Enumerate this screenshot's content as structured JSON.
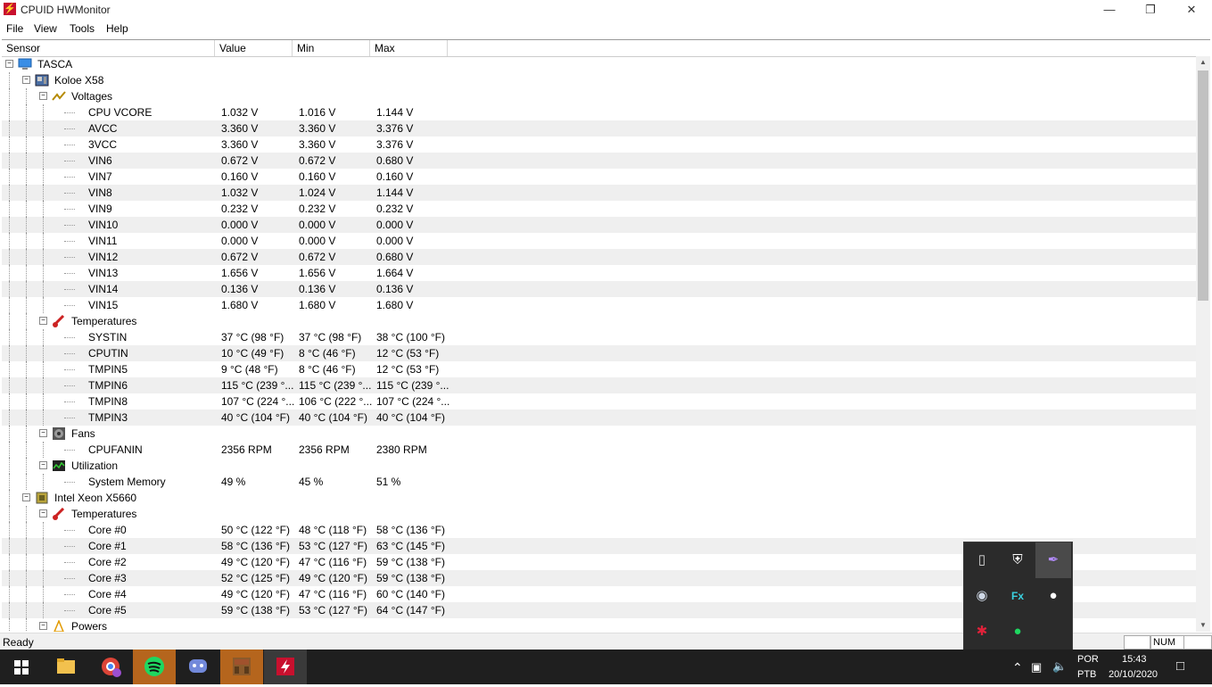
{
  "window": {
    "title": "CPUID HWMonitor",
    "app_icon": "⚡"
  },
  "menu": [
    "File",
    "View",
    "Tools",
    "Help"
  ],
  "columns": [
    "Sensor",
    "Value",
    "Min",
    "Max"
  ],
  "rows": [
    {
      "level": 0,
      "label": "TASCA",
      "icon": "computer-icon",
      "expandable": true
    },
    {
      "level": 1,
      "label": "Koloe X58",
      "icon": "motherboard-icon",
      "expandable": true
    },
    {
      "level": 2,
      "label": "Voltages",
      "icon": "voltage-icon",
      "expandable": true
    },
    {
      "level": 3,
      "label": "CPU VCORE",
      "value": "1.032 V",
      "min": "1.016 V",
      "max": "1.144 V"
    },
    {
      "level": 3,
      "label": "AVCC",
      "value": "3.360 V",
      "min": "3.360 V",
      "max": "3.376 V"
    },
    {
      "level": 3,
      "label": "3VCC",
      "value": "3.360 V",
      "min": "3.360 V",
      "max": "3.376 V"
    },
    {
      "level": 3,
      "label": "VIN6",
      "value": "0.672 V",
      "min": "0.672 V",
      "max": "0.680 V"
    },
    {
      "level": 3,
      "label": "VIN7",
      "value": "0.160 V",
      "min": "0.160 V",
      "max": "0.160 V"
    },
    {
      "level": 3,
      "label": "VIN8",
      "value": "1.032 V",
      "min": "1.024 V",
      "max": "1.144 V"
    },
    {
      "level": 3,
      "label": "VIN9",
      "value": "0.232 V",
      "min": "0.232 V",
      "max": "0.232 V"
    },
    {
      "level": 3,
      "label": "VIN10",
      "value": "0.000 V",
      "min": "0.000 V",
      "max": "0.000 V"
    },
    {
      "level": 3,
      "label": "VIN11",
      "value": "0.000 V",
      "min": "0.000 V",
      "max": "0.000 V"
    },
    {
      "level": 3,
      "label": "VIN12",
      "value": "0.672 V",
      "min": "0.672 V",
      "max": "0.680 V"
    },
    {
      "level": 3,
      "label": "VIN13",
      "value": "1.656 V",
      "min": "1.656 V",
      "max": "1.664 V"
    },
    {
      "level": 3,
      "label": "VIN14",
      "value": "0.136 V",
      "min": "0.136 V",
      "max": "0.136 V"
    },
    {
      "level": 3,
      "label": "VIN15",
      "value": "1.680 V",
      "min": "1.680 V",
      "max": "1.680 V"
    },
    {
      "level": 2,
      "label": "Temperatures",
      "icon": "thermometer-icon",
      "expandable": true
    },
    {
      "level": 3,
      "label": "SYSTIN",
      "value": "37 °C  (98 °F)",
      "min": "37 °C  (98 °F)",
      "max": "38 °C  (100 °F)"
    },
    {
      "level": 3,
      "label": "CPUTIN",
      "value": "10 °C  (49 °F)",
      "min": "8 °C  (46 °F)",
      "max": "12 °C  (53 °F)"
    },
    {
      "level": 3,
      "label": "TMPIN5",
      "value": "9 °C  (48 °F)",
      "min": "8 °C  (46 °F)",
      "max": "12 °C  (53 °F)"
    },
    {
      "level": 3,
      "label": "TMPIN6",
      "value": "115 °C  (239 °...",
      "min": "115 °C  (239 °...",
      "max": "115 °C  (239 °..."
    },
    {
      "level": 3,
      "label": "TMPIN8",
      "value": "107 °C  (224 °...",
      "min": "106 °C  (222 °...",
      "max": "107 °C  (224 °..."
    },
    {
      "level": 3,
      "label": "TMPIN3",
      "value": "40 °C  (104 °F)",
      "min": "40 °C  (104 °F)",
      "max": "40 °C  (104 °F)"
    },
    {
      "level": 2,
      "label": "Fans",
      "icon": "fan-icon",
      "expandable": true
    },
    {
      "level": 3,
      "label": "CPUFANIN",
      "value": "2356 RPM",
      "min": "2356 RPM",
      "max": "2380 RPM"
    },
    {
      "level": 2,
      "label": "Utilization",
      "icon": "utilization-icon",
      "expandable": true
    },
    {
      "level": 3,
      "label": "System Memory",
      "value": "49 %",
      "min": "45 %",
      "max": "51 %"
    },
    {
      "level": 1,
      "label": "Intel Xeon X5660",
      "icon": "cpu-chip-icon",
      "expandable": true
    },
    {
      "level": 2,
      "label": "Temperatures",
      "icon": "thermometer-icon",
      "expandable": true
    },
    {
      "level": 3,
      "label": "Core #0",
      "value": "50 °C  (122 °F)",
      "min": "48 °C  (118 °F)",
      "max": "58 °C  (136 °F)"
    },
    {
      "level": 3,
      "label": "Core #1",
      "value": "58 °C  (136 °F)",
      "min": "53 °C  (127 °F)",
      "max": "63 °C  (145 °F)"
    },
    {
      "level": 3,
      "label": "Core #2",
      "value": "49 °C  (120 °F)",
      "min": "47 °C  (116 °F)",
      "max": "59 °C  (138 °F)"
    },
    {
      "level": 3,
      "label": "Core #3",
      "value": "52 °C  (125 °F)",
      "min": "49 °C  (120 °F)",
      "max": "59 °C  (138 °F)"
    },
    {
      "level": 3,
      "label": "Core #4",
      "value": "49 °C  (120 °F)",
      "min": "47 °C  (116 °F)",
      "max": "60 °C  (140 °F)"
    },
    {
      "level": 3,
      "label": "Core #5",
      "value": "59 °C  (138 °F)",
      "min": "53 °C  (127 °F)",
      "max": "64 °C  (147 °F)"
    },
    {
      "level": 2,
      "label": "Powers",
      "icon": "power-icon",
      "expandable": true
    }
  ],
  "status": {
    "text": "Ready",
    "num": "NUM"
  },
  "taskbar": {
    "apps": [
      "windows-start-icon",
      "file-explorer-icon",
      "chrome-icon",
      "spotify-icon",
      "discord-icon",
      "minecraft-icon",
      "hwmonitor-icon"
    ],
    "lang_top": "POR",
    "lang_bottom": "PTB",
    "time": "15:43",
    "date": "20/10/2020"
  },
  "tray_popup": [
    "usb-icon",
    "security-shield-icon",
    "feather-icon",
    "steam-icon",
    "fx-icon",
    "discord-icon",
    "red-star-icon",
    "spotify-icon"
  ],
  "colors": {
    "accent": "#c8102e",
    "zebra": "#efefef",
    "taskbar": "#1f1f1f"
  }
}
